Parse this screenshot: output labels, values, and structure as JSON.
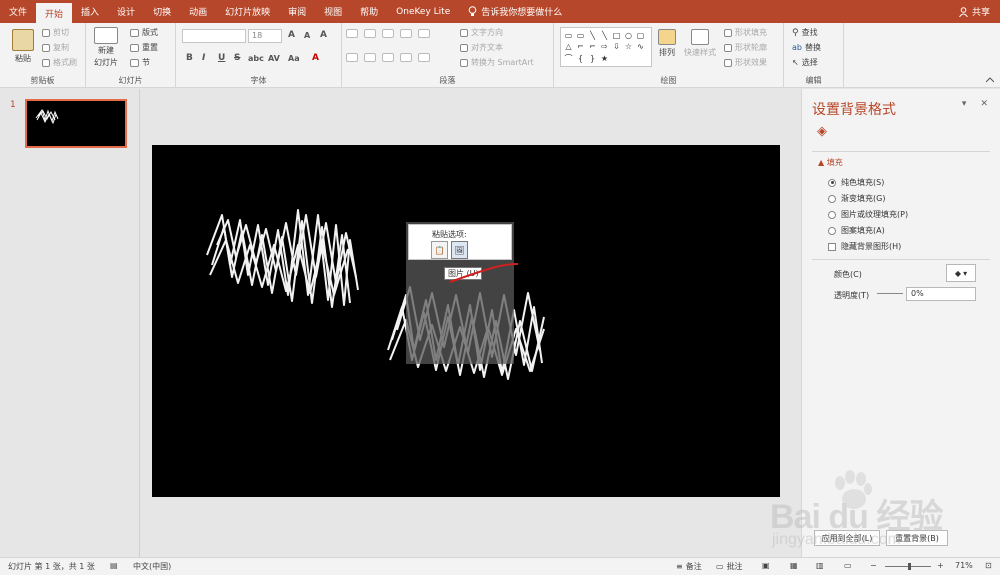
{
  "tabs": [
    "文件",
    "开始",
    "插入",
    "设计",
    "切换",
    "动画",
    "幻灯片放映",
    "审阅",
    "视图",
    "帮助",
    "OneKey Lite"
  ],
  "active_tab": "开始",
  "tell_me": "告诉我你想要做什么",
  "share": "共享",
  "ribbon": {
    "clipboard": {
      "label": "剪贴板",
      "paste": "粘贴",
      "cut": "剪切",
      "copy": "复制",
      "format_painter": "格式刷"
    },
    "slides": {
      "label": "幻灯片",
      "new_slide": "新建",
      "new_slide_2": "幻灯片",
      "layout": "版式",
      "reset": "重置",
      "section": "节"
    },
    "font": {
      "label": "字体",
      "font_size": "18",
      "grow": "A",
      "shrink": "A",
      "clear": "A",
      "bold": "B",
      "italic": "I",
      "underline": "U",
      "strike": "S",
      "shadow": "abc",
      "spacing": "AV",
      "case": "Aa",
      "color": "A"
    },
    "paragraph": {
      "label": "段落",
      "text_direction": "文字方向",
      "align_text": "对齐文本",
      "smartart": "转换为 SmartArt"
    },
    "drawing": {
      "label": "绘图",
      "arrange": "排列",
      "quick_styles": "快速样式",
      "shape_fill": "形状填充",
      "shape_outline": "形状轮廓",
      "shape_effects": "形状效果"
    },
    "editing": {
      "label": "编辑",
      "find": "查找",
      "replace": "替换",
      "select": "选择"
    }
  },
  "slide_number": "1",
  "paste_options": {
    "title": "粘贴选项:",
    "tooltip": "图片 (U)"
  },
  "panel": {
    "title": "设置背景格式",
    "section": "填充",
    "options": [
      "纯色填充(S)",
      "渐变填充(G)",
      "图片或纹理填充(P)",
      "图案填充(A)"
    ],
    "selected_option": "纯色填充(S)",
    "hide_bg": "隐藏背景图形(H)",
    "color_label": "颜色(C)",
    "transparency_label": "透明度(T)",
    "transparency_value": "0%",
    "apply_all": "应用到全部(L)",
    "reset_bg": "重置背景(B)"
  },
  "status": {
    "slide_info": "幻灯片 第 1 张，共 1 张",
    "language": "中文(中国)",
    "notes": "备注",
    "comments": "批注",
    "zoom": "71%",
    "zoom_level": 0.71
  },
  "watermark": {
    "url": "jingyan.baidu.com"
  },
  "colors": {
    "accent": "#b7472a",
    "ribbon": "#f3f3f3",
    "slide_bg": "#000000"
  }
}
